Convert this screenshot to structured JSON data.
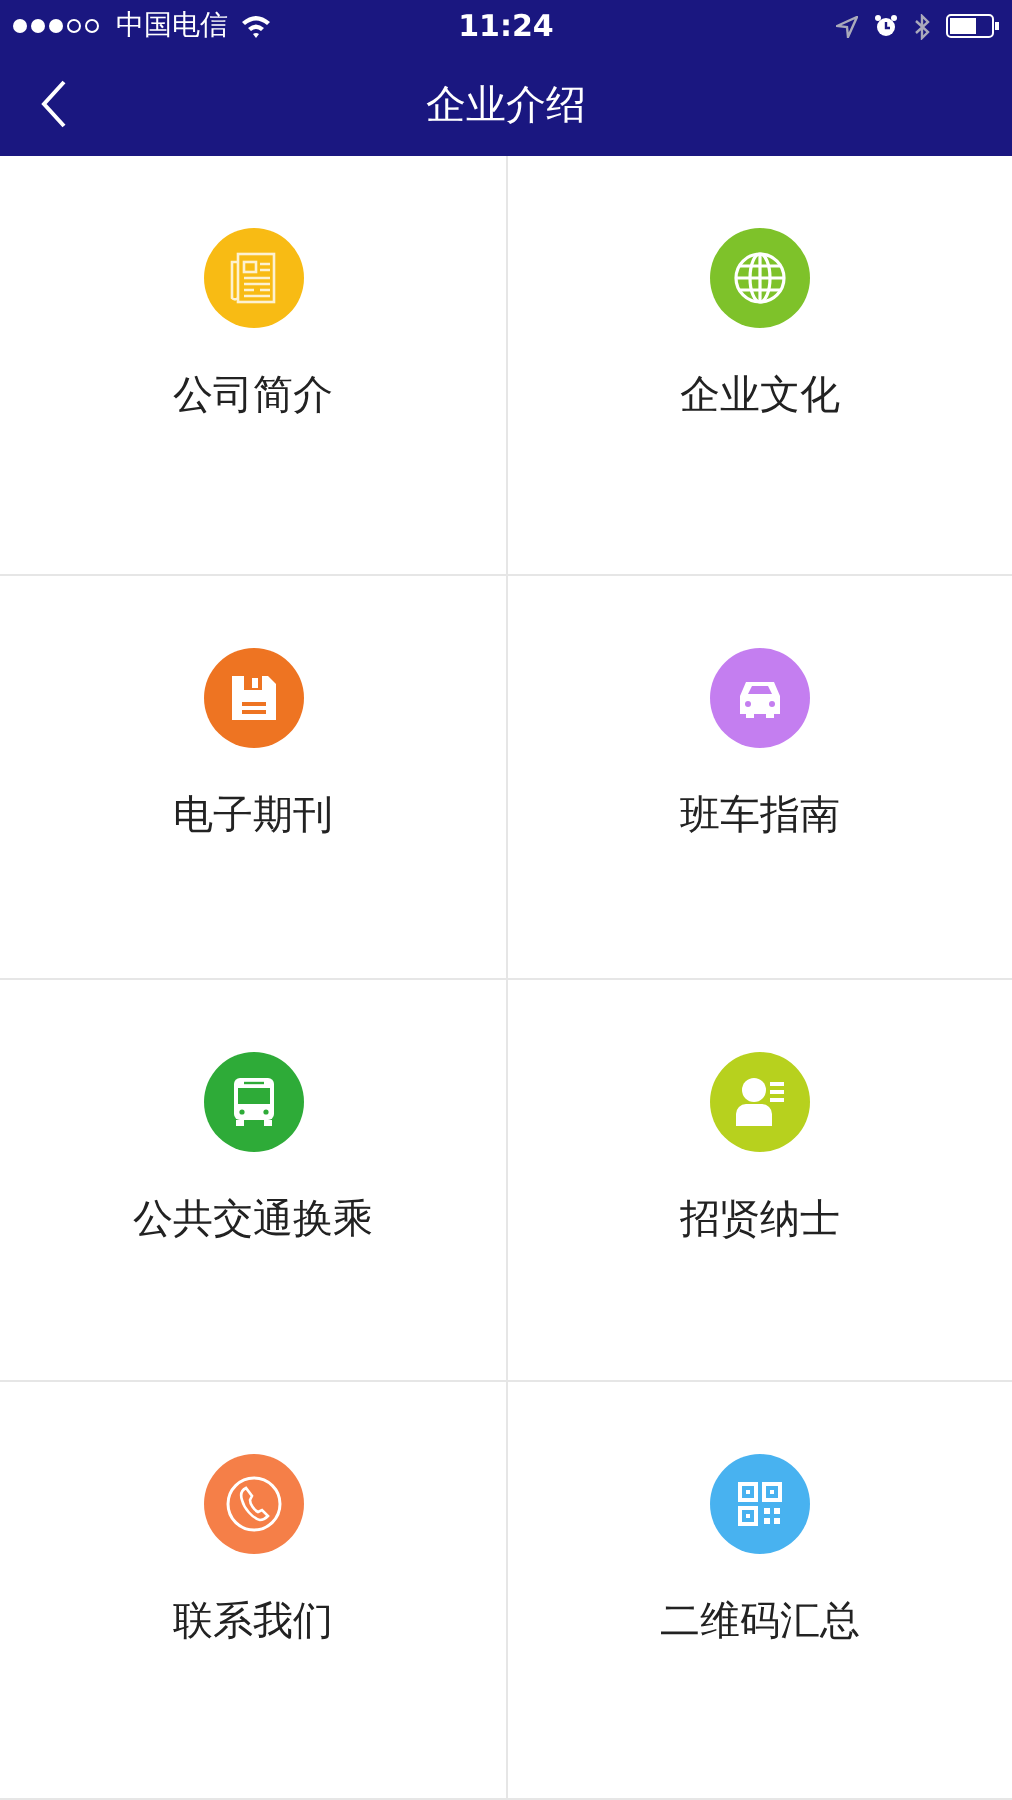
{
  "status_bar": {
    "carrier": "中国电信",
    "time": "11:24"
  },
  "nav_bar": {
    "title": "企业介绍"
  },
  "tiles": [
    {
      "label": "公司简介",
      "kind": "newspaper",
      "color": "#f8bb14"
    },
    {
      "label": "企业文化",
      "kind": "globe",
      "color": "#7ec22a"
    },
    {
      "label": "电子期刊",
      "kind": "floppy",
      "color": "#ee7422"
    },
    {
      "label": "班车指南",
      "kind": "car",
      "color": "#c47ef0"
    },
    {
      "label": "公共交通换乘",
      "kind": "bus",
      "color": "#2eab38"
    },
    {
      "label": "招贤纳士",
      "kind": "person",
      "color": "#b7d11e"
    },
    {
      "label": "联系我们",
      "kind": "phone",
      "color": "#f57f48"
    },
    {
      "label": "二维码汇总",
      "kind": "qr",
      "color": "#48b2f0"
    }
  ]
}
